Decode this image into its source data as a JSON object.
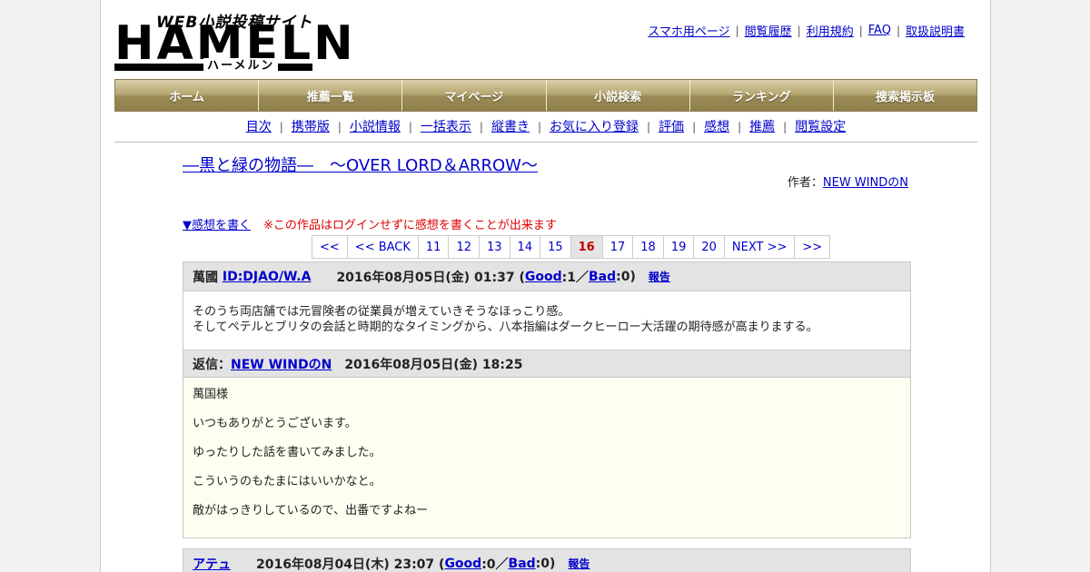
{
  "logo": {
    "tagline": "WEB小説投稿サイト",
    "wordmark": "HAMELN",
    "kana": "ハーメルン"
  },
  "top_links": [
    "スマホ用ページ",
    "閲覧履歴",
    "利用規約",
    "FAQ",
    "取扱説明書"
  ],
  "nav": [
    "ホーム",
    "推薦一覧",
    "マイページ",
    "小説検索",
    "ランキング",
    "捜索掲示板"
  ],
  "subnav": [
    "目次",
    "携帯版",
    "小説情報",
    "一括表示",
    "縦書き",
    "お気に入り登録",
    "評価",
    "感想",
    "推薦",
    "閲覧設定"
  ],
  "novel": {
    "title": "―黒と緑の物語―　～OVER LORD＆ARROW～",
    "author_label": "作者：",
    "author": "NEW WINDのN"
  },
  "write": {
    "link": "▼感想を書く",
    "note": "※この作品はログインせずに感想を書くことが出来ます"
  },
  "pager": {
    "items": [
      "<<",
      "<< BACK",
      "11",
      "12",
      "13",
      "14",
      "15",
      "16",
      "17",
      "18",
      "19",
      "20",
      "NEXT >>",
      ">>"
    ],
    "current": "16"
  },
  "comments": [
    {
      "name": "萬國",
      "id_link": "ID:DJAO/W.A",
      "date": "2016年08月05日(金) 01:37 (",
      "good_label": "Good",
      "good_count": ":1／",
      "bad_label": "Bad",
      "bad_count": ":0)",
      "report": "報告",
      "body": [
        "そのうち両店舗では元冒険者の従業員が増えていきそうなほっこり感。",
        "そしてペテルとブリタの会話と時期的なタイミングから、八本指編はダークヒーロー大活躍の期待感が高まりまする。"
      ],
      "reply": {
        "label": "返信：",
        "author": "NEW WINDのN",
        "date": "2016年08月05日(金) 18:25",
        "lines": [
          "萬国様",
          "いつもありがとうございます。",
          "ゆったりした話を書いてみました。",
          "こういうのもたまにはいいかなと。",
          "敵がはっきりしているので、出番ですよねー"
        ]
      }
    },
    {
      "name_link": "アテュ",
      "date": "2016年08月04日(木) 23:07 (",
      "good_label": "Good",
      "good_count": ":0／",
      "bad_label": "Bad",
      "bad_count": ":0)",
      "report": "報告"
    }
  ],
  "colors": {
    "link": "#0000cc",
    "note": "#e00000",
    "nav_gold": "#b6a872",
    "reply_bg": "#fefff0"
  }
}
